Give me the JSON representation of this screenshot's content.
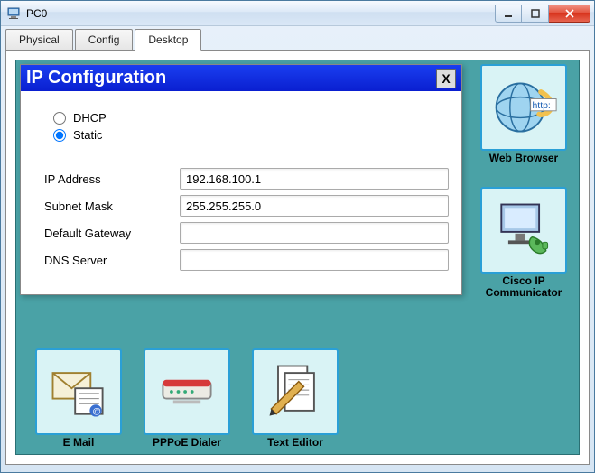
{
  "window": {
    "title": "PC0"
  },
  "tabs": {
    "physical": "Physical",
    "config": "Config",
    "desktop": "Desktop"
  },
  "dialog": {
    "title": "IP Configuration",
    "close": "X",
    "dhcp_label": "DHCP",
    "static_label": "Static",
    "mode": "static",
    "fields": {
      "ip": {
        "label": "IP Address",
        "value": "192.168.100.1"
      },
      "mask": {
        "label": "Subnet Mask",
        "value": "255.255.255.0"
      },
      "gateway": {
        "label": "Default Gateway",
        "value": ""
      },
      "dns": {
        "label": "DNS Server",
        "value": ""
      }
    }
  },
  "apps": {
    "web_browser": "Web Browser",
    "cisco_ip": "Cisco IP Communicator",
    "email": "E Mail",
    "pppoe": "PPPoE Dialer",
    "text_editor": "Text Editor",
    "http_badge": "http:"
  }
}
